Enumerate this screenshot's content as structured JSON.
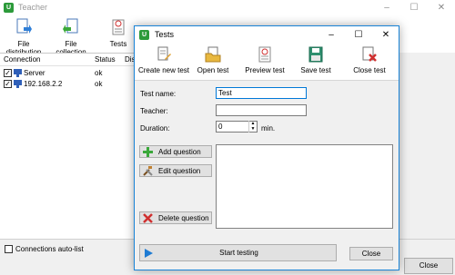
{
  "main_window": {
    "title": "Teacher",
    "app_icon_letter": "U",
    "controls": {
      "minimize": "–",
      "maximize": "☐",
      "close": "✕"
    },
    "toolbar": [
      {
        "label": "File distribution",
        "icon": "file-distribution-icon"
      },
      {
        "label": "File collection",
        "icon": "file-collection-icon"
      },
      {
        "label": "Tests",
        "icon": "tests-icon"
      }
    ],
    "list": {
      "headers": [
        "Connection",
        "Status",
        "Dis"
      ],
      "rows": [
        {
          "name": "Server",
          "status": "ok",
          "checked": true
        },
        {
          "name": "192.168.2.2",
          "status": "ok",
          "checked": true
        }
      ]
    },
    "auto_list_label": "Connections auto-list",
    "close_label": "Close"
  },
  "tests_dialog": {
    "title": "Tests",
    "app_icon_letter": "U",
    "controls": {
      "minimize": "–",
      "maximize": "☐",
      "close": "✕"
    },
    "toolbar": [
      {
        "label": "Create new test",
        "icon": "create-test-icon"
      },
      {
        "label": "Open test",
        "icon": "open-test-icon"
      },
      {
        "label": "Preview test",
        "icon": "preview-test-icon"
      },
      {
        "label": "Save test",
        "icon": "save-icon"
      },
      {
        "label": "Close test",
        "icon": "close-test-icon"
      }
    ],
    "form": {
      "test_name_label": "Test name:",
      "test_name_value": "Test",
      "teacher_label": "Teacher:",
      "teacher_value": "",
      "duration_label": "Duration:",
      "duration_value": "0",
      "duration_unit": "min."
    },
    "buttons": {
      "add_question": "Add question",
      "edit_question": "Edit question",
      "delete_question": "Delete question",
      "start_testing": "Start testing",
      "close": "Close"
    },
    "colors": {
      "accent": "#1883d7",
      "add_green": "#3aa83a",
      "delete_red": "#d03030"
    }
  }
}
